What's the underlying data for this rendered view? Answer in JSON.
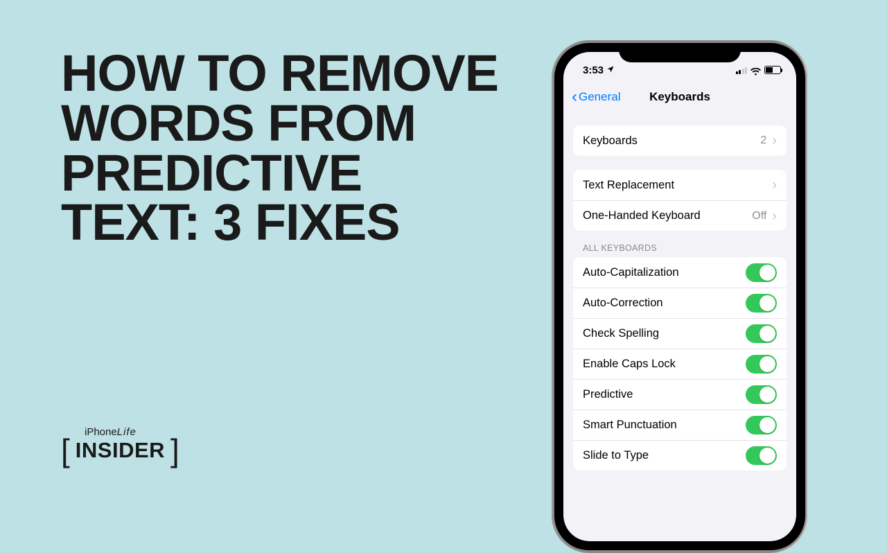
{
  "headline": "HOW TO REMOVE WORDS FROM PREDICTIVE TEXT: 3 FIXES",
  "badge": {
    "top_brand": "iPhone",
    "top_suffix": "Life",
    "main": "INSIDER",
    "bracket_open": "[",
    "bracket_close": "]"
  },
  "phone": {
    "status": {
      "time": "3:53",
      "location_icon": "location-arrow"
    },
    "nav": {
      "back_label": "General",
      "title": "Keyboards"
    },
    "group1": [
      {
        "label": "Keyboards",
        "value": "2",
        "chevron": true
      }
    ],
    "group2": [
      {
        "label": "Text Replacement",
        "value": "",
        "chevron": true
      },
      {
        "label": "One-Handed Keyboard",
        "value": "Off",
        "chevron": true
      }
    ],
    "section_header": "ALL KEYBOARDS",
    "toggles": [
      {
        "label": "Auto-Capitalization",
        "on": true
      },
      {
        "label": "Auto-Correction",
        "on": true
      },
      {
        "label": "Check Spelling",
        "on": true
      },
      {
        "label": "Enable Caps Lock",
        "on": true
      },
      {
        "label": "Predictive",
        "on": true
      },
      {
        "label": "Smart Punctuation",
        "on": true
      },
      {
        "label": "Slide to Type",
        "on": true
      }
    ]
  }
}
